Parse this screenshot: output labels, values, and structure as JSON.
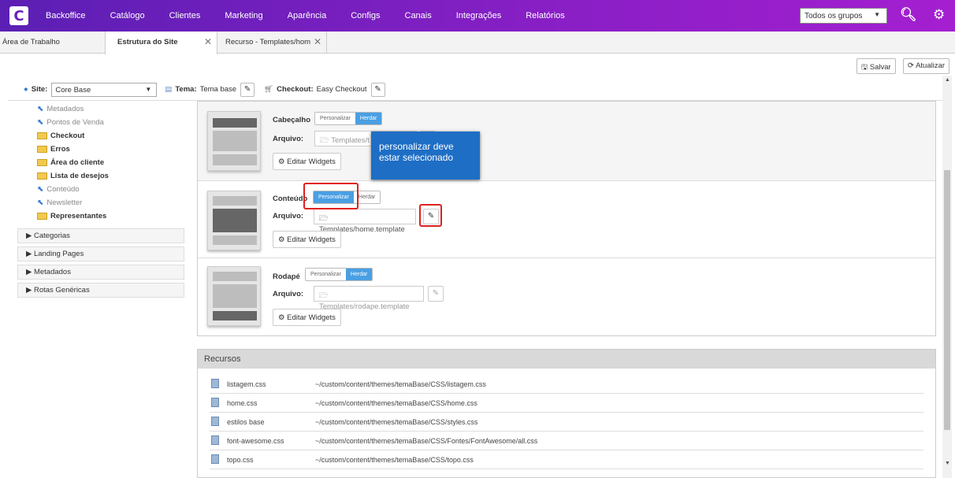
{
  "nav": {
    "items": [
      "Backoffice",
      "Catálogo",
      "Clientes",
      "Marketing",
      "Aparência",
      "Configs",
      "Canais",
      "Integrações",
      "Relatórios"
    ]
  },
  "group_select": {
    "value": "Todos os grupos"
  },
  "tabs": [
    {
      "label": "Área de Trabalho"
    },
    {
      "label": "Estrutura do Site"
    },
    {
      "label": "Recurso - Templates/hom"
    }
  ],
  "toolbar": {
    "save": "Salvar",
    "refresh": "Atualizar"
  },
  "sitebar": {
    "site_label": "Site:",
    "site_value": "Core Base",
    "tema_label": "Tema:",
    "tema_value": "Tema base",
    "checkout_label": "Checkout:",
    "checkout_value": "Easy Checkout"
  },
  "tree": {
    "items": [
      "Metadados",
      "Pontos de Venda",
      "Checkout",
      "Erros",
      "Área do cliente",
      "Lista de desejos",
      "Conteúdo",
      "Newsletter",
      "Representantes"
    ]
  },
  "accordion": [
    "Categorias",
    "Landing Pages",
    "Metadados",
    "Rotas Genéricas"
  ],
  "sections": {
    "header": {
      "label": "Cabeçalho",
      "file": "Templates/t"
    },
    "content": {
      "label": "Conteúdo",
      "file": "Templates/home.template"
    },
    "footer": {
      "label": "Rodapé",
      "file": "Templates/rodape.template"
    },
    "personalize": "Personalizar",
    "inherit": "Herdar",
    "file_label": "Arquivo:",
    "edit_widgets": "Editar Widgets"
  },
  "tooltip": "personalizar deve estar selecionado",
  "resources": {
    "title": "Recursos",
    "rows": [
      {
        "name": "listagem.css",
        "path": "~/custom/content/themes/temaBase/CSS/listagem.css"
      },
      {
        "name": "home.css",
        "path": "~/custom/content/themes/temaBase/CSS/home.css"
      },
      {
        "name": "estilos base",
        "path": "~/custom/content/themes/temaBase/CSS/styles.css"
      },
      {
        "name": "font-awesome.css",
        "path": "~/custom/content/themes/temaBase/CSS/Fontes/FontAwesome/all.css"
      },
      {
        "name": "topo.css",
        "path": "~/custom/content/themes/temaBase/CSS/topo.css"
      }
    ]
  }
}
